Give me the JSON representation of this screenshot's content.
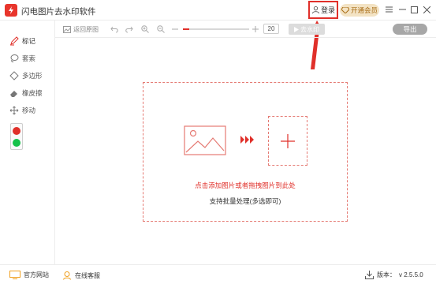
{
  "app": {
    "title": "闪电图片去水印软件"
  },
  "titlebar": {
    "login_label": "登录",
    "vip_label": "开通会员"
  },
  "sidebar": {
    "tools": [
      {
        "label": "标记"
      },
      {
        "label": "套索"
      },
      {
        "label": "多边形"
      },
      {
        "label": "橡皮擦"
      },
      {
        "label": "移动"
      }
    ],
    "colors": [
      "#e0302a",
      "#16c24a"
    ]
  },
  "toolbar": {
    "back_label": "返回原图",
    "zoom_value": "20",
    "zoom_level": 0.1,
    "remove_label": "去水印",
    "export_label": "导出"
  },
  "dropzone": {
    "hint_primary": "点击添加图片或者拖拽图片到此处",
    "hint_secondary": "支持批量处理(多选即可)"
  },
  "footer": {
    "website_label": "官方网站",
    "support_label": "在线客服",
    "version_label": "版本：",
    "version_value": "v 2.5.5.0"
  },
  "colors": {
    "accent": "#e0302a",
    "vip_bg": "#f3e3c4",
    "vip_text": "#a86c14"
  }
}
